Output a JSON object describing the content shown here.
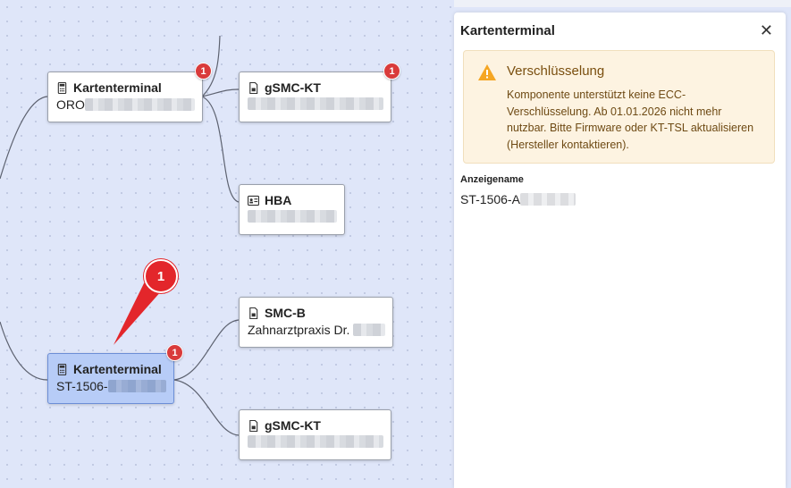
{
  "nodes": {
    "kt_top": {
      "title": "Kartenterminal",
      "sub_visible": "ORO",
      "badge": "1"
    },
    "gsmc_top": {
      "title": "gSMC-KT",
      "badge": "1"
    },
    "hba": {
      "title": "HBA"
    },
    "smcb": {
      "title": "SMC-B",
      "sub_visible": "Zahnarztpraxis Dr."
    },
    "kt_selected": {
      "title": "Kartenterminal",
      "sub_visible": "ST-1506-",
      "badge": "1"
    },
    "gsmc_bottom": {
      "title": "gSMC-KT"
    }
  },
  "annotation_marker": "1",
  "panel": {
    "title": "Kartenterminal",
    "close_glyph": "✕",
    "alert": {
      "title": "Verschlüsselung",
      "text": "Komponente unterstützt keine ECC-Verschlüsselung. Ab 01.01.2026 nicht mehr nutzbar. Bitte Firmware oder KT-TSL aktualisieren (Hersteller kontaktieren).",
      "color": "#f5a623"
    },
    "field_label": "Anzeigename",
    "field_value_visible": "ST-1506-A"
  },
  "colors": {
    "badge": "#d93b3b",
    "marker": "#e3262b",
    "selected": "#b7ccf7"
  },
  "icons": {
    "terminal": "card-terminal-icon",
    "card": "sim-card-icon",
    "hba": "id-card-icon",
    "warning": "warning-triangle-icon"
  }
}
